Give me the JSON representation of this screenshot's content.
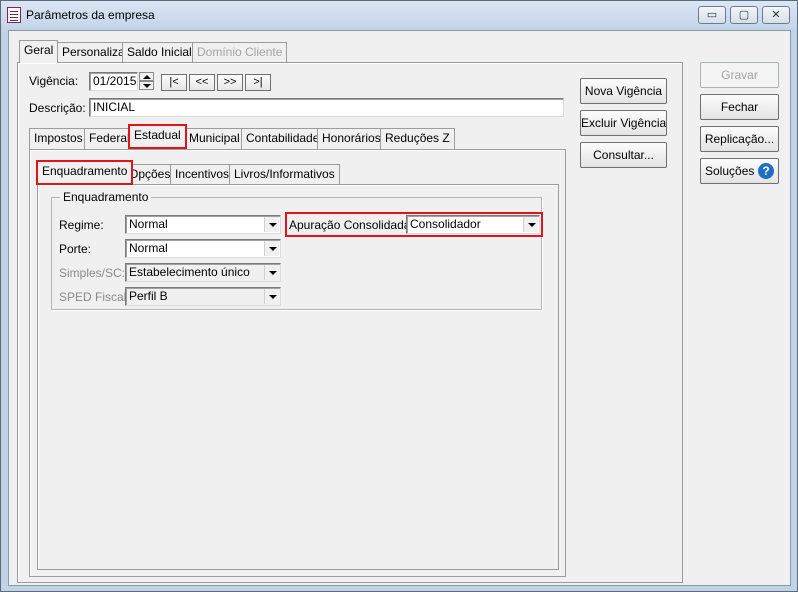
{
  "window": {
    "title": "Parâmetros da empresa",
    "controls": {
      "minimize": "▭",
      "maximize": "▢",
      "close": "✕"
    }
  },
  "main_tabs": [
    "Geral",
    "Personaliza",
    "Saldo Inicial",
    "Domínio Cliente"
  ],
  "vigencia": {
    "label": "Vigência:",
    "value": "01/2015",
    "nav": [
      "|<",
      "<<",
      ">>",
      ">|"
    ]
  },
  "descricao": {
    "label": "Descrição:",
    "value": "INICIAL"
  },
  "sub_tabs": [
    "Impostos",
    "Federal",
    "Estadual",
    "Municipal",
    "Contabilidade",
    "Honorários",
    "Reduções Z"
  ],
  "estadual_tabs": [
    "Enquadramento",
    "Opções",
    "Incentivos",
    "Livros/Informativos"
  ],
  "enquadramento": {
    "group_title": "Enquadramento",
    "regime": {
      "label": "Regime:",
      "value": "Normal"
    },
    "porte": {
      "label": "Porte:",
      "value": "Normal"
    },
    "simples": {
      "label": "Simples/SC:",
      "value": "Estabelecimento único"
    },
    "sped": {
      "label": "SPED Fiscal:",
      "value": "Perfil B"
    },
    "apuracao": {
      "label": "Apuração Consolidada:",
      "value": "Consolidador"
    }
  },
  "middle_buttons": [
    "Nova Vigência",
    "Excluir Vigência",
    "Consultar..."
  ],
  "right_buttons": {
    "gravar": "Gravar",
    "fechar": "Fechar",
    "replicacao": "Replicação...",
    "solucoes": "Soluções",
    "help": "?"
  },
  "colors": {
    "highlight": "#e0141b",
    "title_bg": "#c4d4e8",
    "help_icon": "#1f6fc5"
  }
}
